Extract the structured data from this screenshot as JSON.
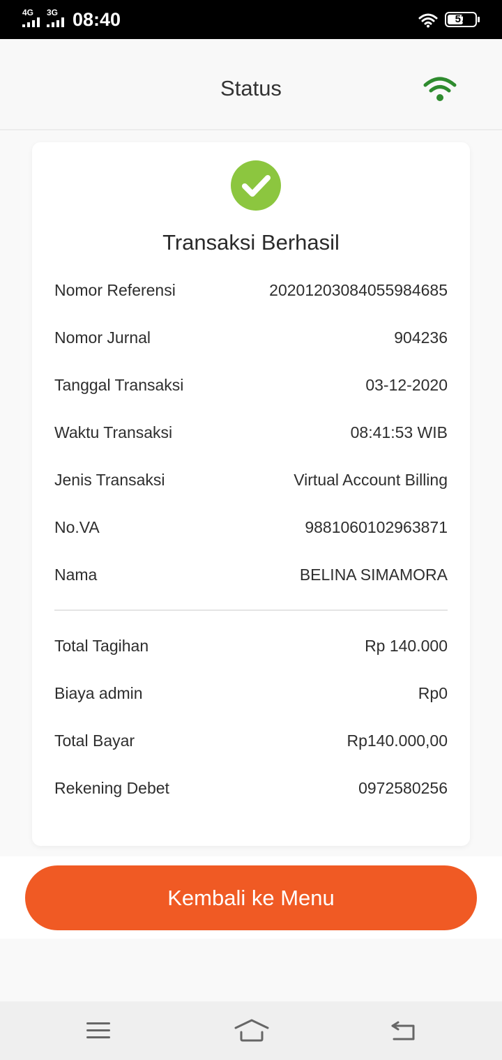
{
  "status_bar": {
    "network_1": "4G",
    "network_2": "3G",
    "time": "08:40",
    "battery": "57",
    "battery_level": 0.57,
    "icons": [
      "signal-bars-icon",
      "wifi-icon",
      "battery-icon"
    ]
  },
  "header": {
    "title": "Status",
    "signal_icon": "wifi-signal-icon",
    "signal_color": "#2e8b2e"
  },
  "receipt": {
    "status_icon": "check-circle-icon",
    "status_icon_color": "#8cc63f",
    "title": "Transaksi Berhasil",
    "details": [
      {
        "label": "Nomor Referensi",
        "value": "20201203084055984685"
      },
      {
        "label": "Nomor Jurnal",
        "value": "904236"
      },
      {
        "label": "Tanggal Transaksi",
        "value": "03-12-2020"
      },
      {
        "label": "Waktu Transaksi",
        "value": "08:41:53 WIB"
      },
      {
        "label": "Jenis Transaksi",
        "value": "Virtual Account Billing"
      },
      {
        "label": "No.VA",
        "value": "9881060102963871"
      },
      {
        "label": "Nama",
        "value": "BELINA SIMAMORA"
      }
    ],
    "amounts": [
      {
        "label": "Total Tagihan",
        "value": "Rp 140.000"
      },
      {
        "label": "Biaya admin",
        "value": "Rp0"
      },
      {
        "label": "Total Bayar",
        "value": "Rp140.000,00"
      },
      {
        "label": "Rekening Debet",
        "value": "0972580256"
      }
    ]
  },
  "actions": {
    "back_to_menu": "Kembali ke Menu",
    "button_color": "#f05a24"
  },
  "nav_bar": {
    "icons": [
      "menu-icon",
      "home-icon",
      "back-icon"
    ]
  }
}
